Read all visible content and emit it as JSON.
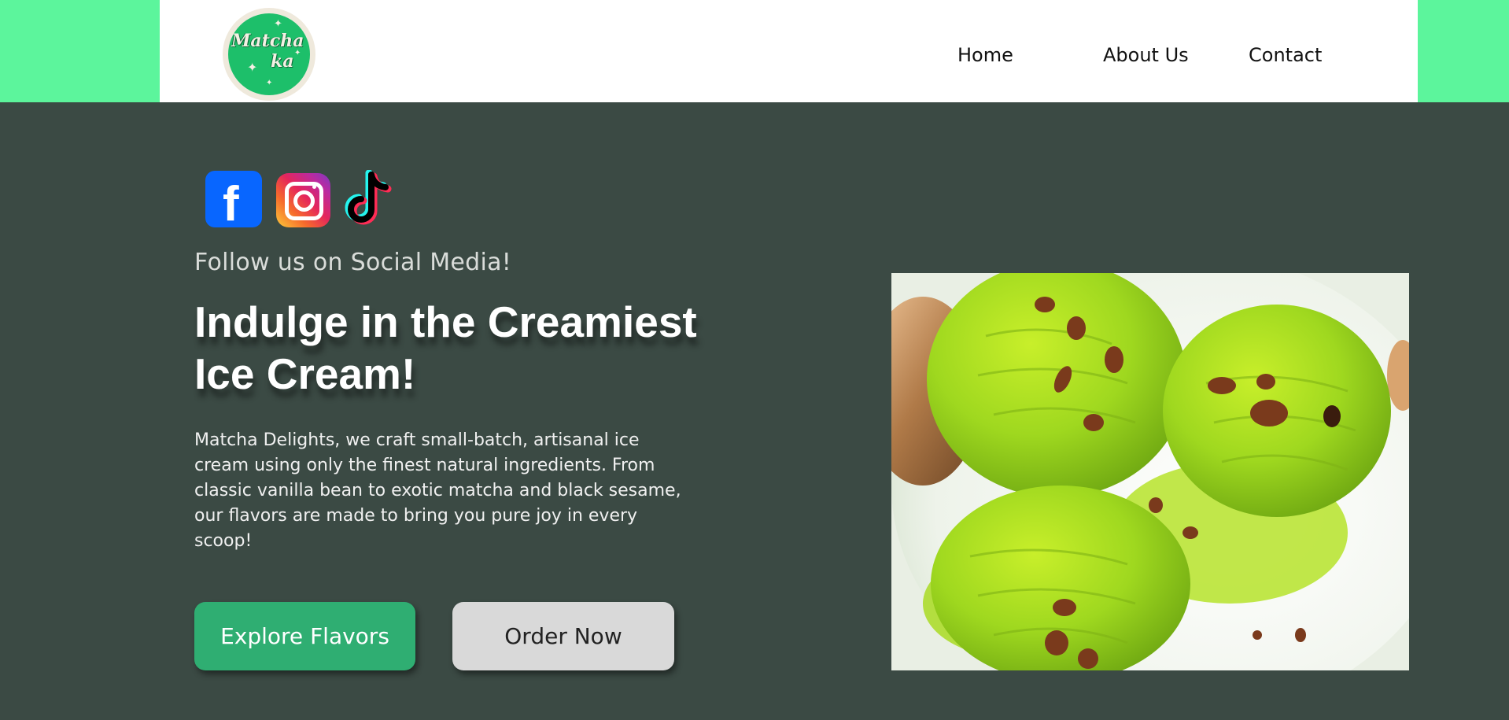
{
  "header": {
    "logo": {
      "line1": "Matcha",
      "line2": "ka"
    },
    "nav": [
      {
        "label": "Home"
      },
      {
        "label": "About Us"
      },
      {
        "label": "Contact"
      }
    ]
  },
  "social": {
    "icons": [
      "facebook-icon",
      "instagram-icon",
      "tiktok-icon"
    ],
    "follow_text": "Follow us on Social Media!"
  },
  "hero": {
    "headline_line1": "Indulge in the Creamiest",
    "headline_line2": "Ice Cream!",
    "description": "Matcha Delights, we craft small-batch, artisanal ice cream using only the finest natural ingredients. From classic vanilla bean to exotic matcha and black sesame, our flavors are made to bring you pure joy in every scoop!",
    "primary_button": "Explore Flavors",
    "secondary_button": "Order Now",
    "image_subject": "matcha-ice-cream-scoops"
  },
  "colors": {
    "header_accent": "#5cf59c",
    "hero_background": "#3b4a44",
    "primary_button": "#2fae72",
    "secondary_button": "#d9d9d9",
    "logo_green": "#1dbf6a"
  }
}
